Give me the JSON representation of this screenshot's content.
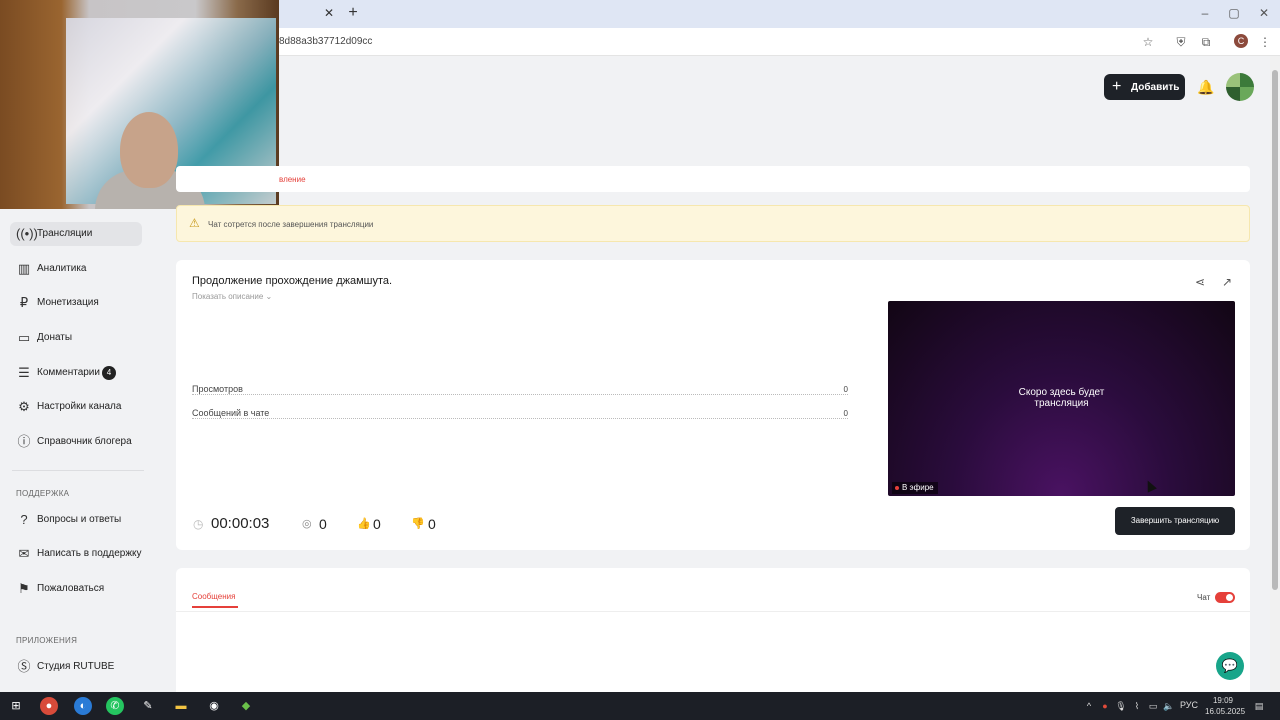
{
  "browser": {
    "url_fragment": "8d88a3b37712d09cc",
    "profile_initial": "C"
  },
  "header": {
    "add_label": "Добавить"
  },
  "sidebar": {
    "items": [
      {
        "label": "Трансляции",
        "icon": "broadcast-icon"
      },
      {
        "label": "Аналитика",
        "icon": "analytics-icon"
      },
      {
        "label": "Монетизация",
        "icon": "monetization-icon"
      },
      {
        "label": "Донаты",
        "icon": "donations-icon"
      },
      {
        "label": "Комментарии",
        "icon": "comments-icon",
        "badge": "4"
      },
      {
        "label": "Настройки канала",
        "icon": "settings-icon"
      },
      {
        "label": "Справочник блогера",
        "icon": "handbook-icon"
      }
    ],
    "support_title": "ПОДДЕРЖКА",
    "support_items": [
      {
        "label": "Вопросы и ответы"
      },
      {
        "label": "Написать в поддержку"
      },
      {
        "label": "Пожаловаться"
      }
    ],
    "apps_title": "ПРИЛОЖЕНИЯ",
    "apps_items": [
      {
        "label": "Студия RUTUBE"
      }
    ]
  },
  "main": {
    "tab_label": "вление",
    "warning": "Чат сотрется после завершения трансляции",
    "stream": {
      "title": "Продолжение прохождение джамшута.",
      "show_description": "Показать описание ⌄",
      "stats": [
        {
          "label": "Просмотров",
          "value": "0"
        },
        {
          "label": "Сообщений в чате",
          "value": "0"
        }
      ],
      "player_message_line1": "Скоро здесь будет",
      "player_message_line2": "трансляция",
      "live_label": "В эфире",
      "timer": "00:00:03",
      "viewers": "0",
      "likes": "0",
      "dislikes": "0",
      "end_button": "Завершить трансляцию"
    },
    "chat": {
      "messages_tab": "Сообщения",
      "chat_label": "Чат",
      "chat_enabled": true
    }
  },
  "taskbar": {
    "lang": "РУС",
    "time": "19:09",
    "date": "16.05.2025"
  },
  "colors": {
    "accent_red": "#e5403a",
    "dark_button": "#1e2228",
    "help_green": "#18a58a",
    "warning_bg": "#fdf6dc"
  }
}
